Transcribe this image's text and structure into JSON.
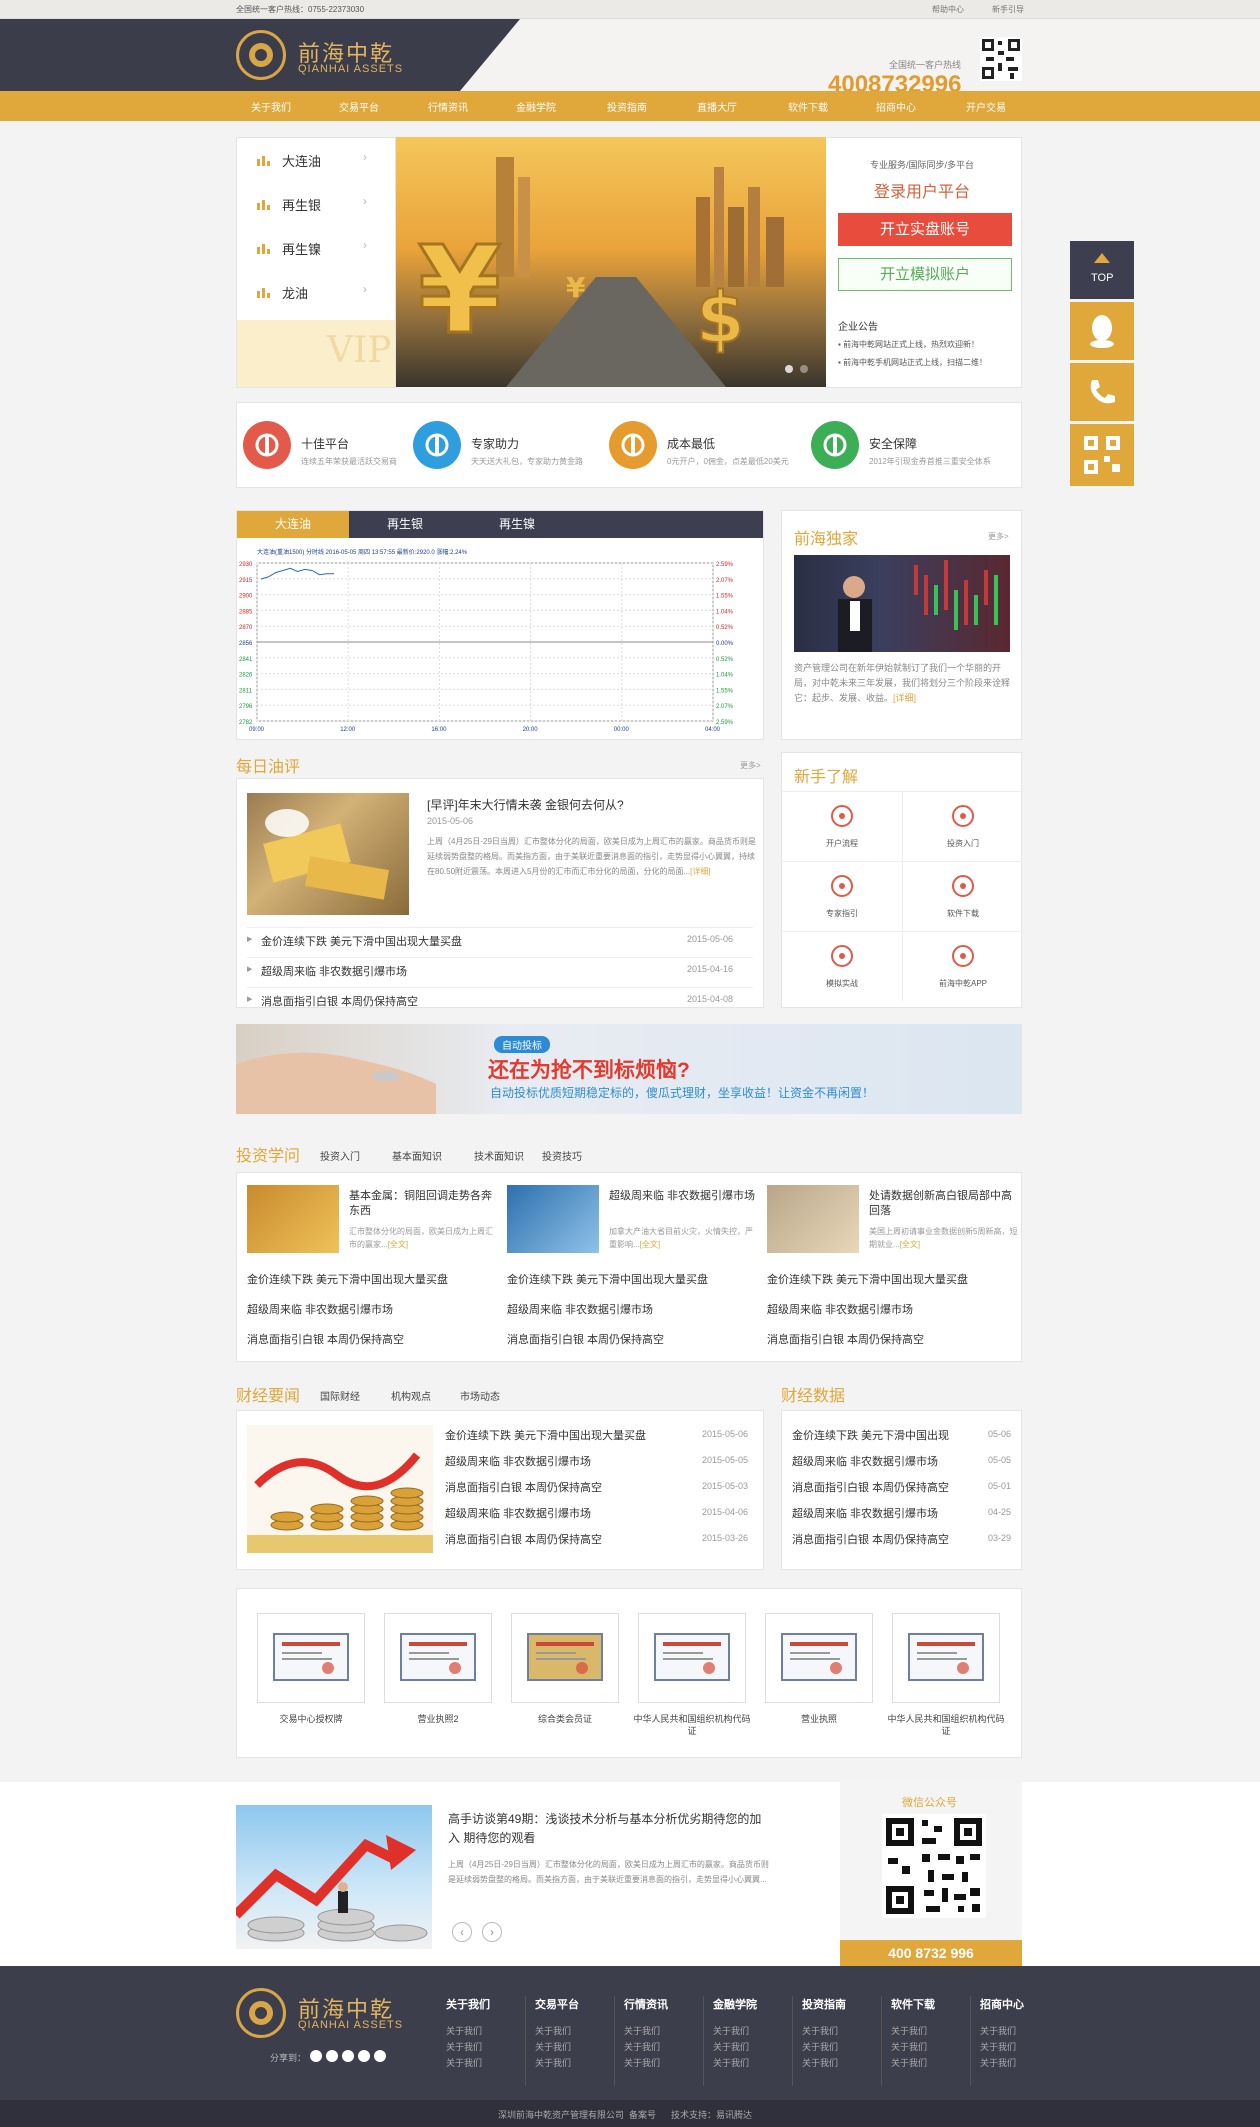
{
  "topbar": {
    "hotline": "全国统一客户热线：0755-22373030",
    "links": [
      "帮助中心",
      "新手引导"
    ]
  },
  "header": {
    "logo_cn": "前海中乾",
    "logo_en": "QIANHAI ASSETS",
    "hotline_label": "全国统一客户热线",
    "hotline_number": "4008732996"
  },
  "nav": [
    "关于我们",
    "交易平台",
    "行情资讯",
    "金融学院",
    "投资指南",
    "直播大厅",
    "软件下载",
    "招商中心",
    "开户交易"
  ],
  "products": [
    "大连油",
    "再生银",
    "再生镍",
    "龙油"
  ],
  "banner": {
    "vip": "VIP"
  },
  "login": {
    "tagline": "专业服务/国际同步/多平台",
    "title": "登录用户平台",
    "real_btn": "开立实盘账号",
    "demo_btn": "开立模拟账户",
    "notice_title": "企业公告",
    "notices": [
      "前海中乾网站正式上线，热烈欢迎新！",
      "前海中乾手机网站正式上线，扫描二维！"
    ]
  },
  "features": [
    {
      "title": "十佳平台",
      "sub": "连续五年荣获最活跃交易商",
      "color": "#e35a4b",
      "icon": "medal-icon"
    },
    {
      "title": "专家助力",
      "sub": "天天送大礼包，专家助力黄金路",
      "color": "#2e9ede",
      "icon": "expert-icon"
    },
    {
      "title": "成本最低",
      "sub": "0元开户，0佣金，点差最低20美元",
      "color": "#e59b2e",
      "icon": "chart-icon"
    },
    {
      "title": "安全保障",
      "sub": "2012年引现金券首推三重安全体系",
      "color": "#3bae56",
      "icon": "shield-icon"
    }
  ],
  "quote": {
    "tabs": [
      "大连油",
      "再生银",
      "再生镍"
    ],
    "header": "大连油(重油1500)  分时线  2016-05-05  周四  13:57:55  最新价:2920.0  涨幅:2.24%",
    "yticks": [
      "2930",
      "2915",
      "2900",
      "2885",
      "2870",
      "2856",
      "2841",
      "2826",
      "2811",
      "2796",
      "2782"
    ],
    "rticks": [
      "2.59%",
      "2.07%",
      "1.55%",
      "1.04%",
      "0.52%",
      "0.00%",
      "0.52%",
      "1.04%",
      "1.55%",
      "2.07%",
      "2.59%"
    ],
    "xticks": [
      "09:00",
      "12:00",
      "16:00",
      "20:00",
      "00:00",
      "04:00"
    ]
  },
  "chart_data": {
    "type": "line",
    "x": [
      "09:00",
      "09:30",
      "10:00",
      "10:30",
      "11:00",
      "11:30",
      "12:00",
      "12:30",
      "13:00",
      "13:30",
      "14:00"
    ],
    "values": [
      2915,
      2917,
      2921,
      2923,
      2925,
      2922,
      2924,
      2923,
      2919,
      2920,
      2920
    ],
    "ylim": [
      2782,
      2930
    ],
    "grid": true
  },
  "exclusive": {
    "title": "前海独家",
    "more": "更多>",
    "text": "资产管理公司在新年伊始就制订了我们一个华丽的开局，对中乾未来三年发展，我们将划分三个阶段来诠释它：起步、发展、收益。",
    "link": "[详细]"
  },
  "daily": {
    "title": "每日油评",
    "more": "更多>",
    "lead_title": "[早评]年末大行情未袭 金银何去何从?",
    "lead_date": "2015-05-06",
    "lead_text": "上周（4月25日-29日当周）汇市整体分化的局面，欧美日成为上周汇市的赢家。商品货币则是延续弱势盘整的格局。而美指方面，由于美联近重要消息面的指引，走势显得小心翼翼，持续在80.50附近震荡。本周进入5月份的汇市而汇市分化的局面，分化的局面...",
    "lead_link": "[详细]",
    "items": [
      {
        "t": "金价连续下跌 美元下滑中国出现大量买盘",
        "d": "2015-05-06"
      },
      {
        "t": "超级周来临 非农数据引爆市场",
        "d": "2015-04-16"
      },
      {
        "t": "消息面指引白银 本周仍保持高空",
        "d": "2015-04-08"
      }
    ]
  },
  "newbie": {
    "title": "新手了解",
    "items": [
      "开户流程",
      "投资入门",
      "专家指引",
      "软件下载",
      "模拟实战",
      "前海中乾APP"
    ]
  },
  "ad": {
    "tag": "自动投标",
    "title": "还在为抢不到标烦恼?",
    "sub": "自动投标优质短期稳定标的，傻瓜式理财，坐享收益！让资金不再闲置！"
  },
  "learn": {
    "title": "投资学问",
    "tabs": [
      "投资入门",
      "基本面知识",
      "技术面知识",
      "投资技巧"
    ],
    "cols": [
      {
        "title": "基本金属：铜阻回调走势各奔东西",
        "text": "汇市整体分化的局面，欧美日成为上周汇市的赢家...",
        "link": "[全文]",
        "items": [
          "金价连续下跌 美元下滑中国出现大量买盘",
          "超级周来临 非农数据引爆市场",
          "消息面指引白银 本周仍保持高空"
        ]
      },
      {
        "title": "超级周来临 非农数据引爆市场",
        "text": "加拿大产油大省目前火灾，火情失控，严重影响...",
        "link": "[全文]",
        "items": [
          "金价连续下跌 美元下滑中国出现大量买盘",
          "超级周来临 非农数据引爆市场",
          "消息面指引白银 本周仍保持高空"
        ]
      },
      {
        "title": "处请数据创新高白银局部中高回落",
        "text": "美国上周初请事业金数据创新5周新高，短期就业...",
        "link": "[全文]",
        "items": [
          "金价连续下跌 美元下滑中国出现大量买盘",
          "超级周来临 非农数据引爆市场",
          "消息面指引白银 本周仍保持高空"
        ]
      }
    ]
  },
  "finance": {
    "title": "财经要闻",
    "tabs": [
      "国际财经",
      "机构观点",
      "市场动态"
    ],
    "items": [
      {
        "t": "金价连续下跌 美元下滑中国出现大量买盘",
        "d": "2015-05-06"
      },
      {
        "t": "超级周来临 非农数据引爆市场",
        "d": "2015-05-05"
      },
      {
        "t": "消息面指引白银 本周仍保持高空",
        "d": "2015-05-03"
      },
      {
        "t": "超级周来临 非农数据引爆市场",
        "d": "2015-04-06"
      },
      {
        "t": "消息面指引白银 本周仍保持高空",
        "d": "2015-03-26"
      }
    ]
  },
  "findata": {
    "title": "财经数据",
    "items": [
      {
        "t": "金价连续下跌 美元下滑中国出现",
        "d": "05-06"
      },
      {
        "t": "超级周来临 非农数据引爆市场",
        "d": "05-05"
      },
      {
        "t": "消息面指引白银 本周仍保持高空",
        "d": "05-01"
      },
      {
        "t": "超级周来临 非农数据引爆市场",
        "d": "04-25"
      },
      {
        "t": "消息面指引白银 本周仍保持高空",
        "d": "03-29"
      }
    ]
  },
  "certs": [
    "交易中心授权牌",
    "营业执照2",
    "综合类会员证",
    "中华人民共和国组织机构代码证",
    "营业执照",
    "中华人民共和国组织机构代码证"
  ],
  "interview": {
    "title": "高手访谈第49期：浅谈技术分析与基本分析优劣期待您的加入 期待您的观看",
    "text": "上周（4月25日-29日当周）汇市整体分化的局面，欧美日成为上周汇市的赢家。商品货币则是延续弱势盘整的格局。而美指方面，由于美联近重要消息面的指引，走势显得小心翼翼...",
    "wechat_title": "微信公众号",
    "phone": "400 8732 996"
  },
  "right_bar": {
    "top": "TOP"
  },
  "footer": {
    "logo_cn": "前海中乾",
    "logo_en": "QIANHAI ASSETS",
    "share": "分享到：",
    "cols": [
      "关于我们",
      "交易平台",
      "行情资讯",
      "金融学院",
      "投资指南",
      "软件下载",
      "招商中心"
    ],
    "sub": "关于我们",
    "copyright": "深圳前海中乾资产管理有限公司  备案号      技术支持：易讯腾达"
  },
  "colors": {
    "accent": "#e0a73a",
    "dark": "#3c3d4a",
    "red": "#e74c3c"
  }
}
